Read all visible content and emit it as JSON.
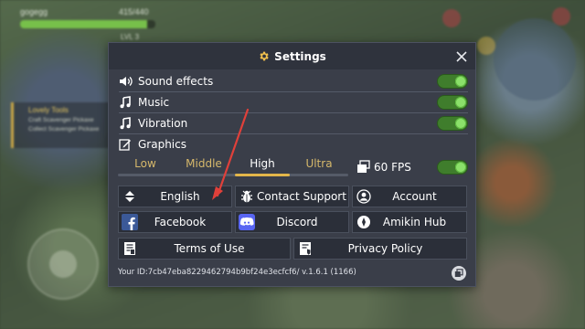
{
  "background": {
    "player_name": "gogegg",
    "hp_text": "415/440",
    "hp_fraction": 0.94,
    "level_text": "LVL 3",
    "quest_title": "Lovely Tools",
    "quest_items": [
      "Craft Scavenger Pickaxe",
      "Collect Scavenger Pickaxe"
    ]
  },
  "settings": {
    "title": "Settings",
    "rows": [
      {
        "label": "Sound effects",
        "icon": "speaker-icon",
        "toggle_on": true
      },
      {
        "label": "Music",
        "icon": "music-note-icon",
        "toggle_on": true
      },
      {
        "label": "Vibration",
        "icon": "music-note-icon",
        "toggle_on": true
      },
      {
        "label": "Graphics",
        "icon": "edit-icon"
      }
    ],
    "graphics": {
      "options": [
        "Low",
        "Middle",
        "High",
        "Ultra"
      ],
      "selected": "High"
    },
    "fps": {
      "label": "60 FPS",
      "icon": "layers-icon",
      "toggle_on": true
    },
    "buttons": {
      "english": "English",
      "contact_support": "Contact Support",
      "account": "Account",
      "facebook": "Facebook",
      "discord": "Discord",
      "amikin_hub": "Amikin Hub",
      "terms": "Terms of Use",
      "privacy": "Privacy Policy"
    },
    "footer": "Your ID:7cb47eba8229462794b9bf24e3ecfcf6/  v.1.6.1 (1166)"
  },
  "colors": {
    "panel": "#3a3e49",
    "toggle_on": "#8be06a",
    "accent_gold": "#e3b64a",
    "annotation_arrow": "#e0403a",
    "facebook_blue": "#3b5998",
    "discord_blue": "#5865f2"
  }
}
